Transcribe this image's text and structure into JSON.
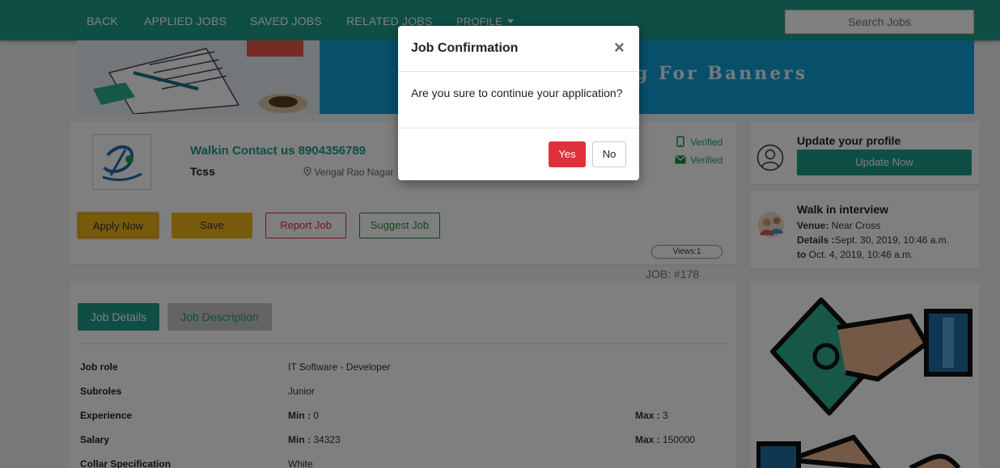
{
  "nav": {
    "back": "BACK",
    "applied": "APPLIED JOBS",
    "saved": "SAVED JOBS",
    "related": "RELATED JOBS",
    "profile": "PROFILE",
    "search_placeholder": "Search Jobs"
  },
  "banner": {
    "text": "g For Banners"
  },
  "job": {
    "title": "Walkin Contact us 8904356789",
    "company": "Tcss",
    "location": "Vengal Rao Nagar",
    "phone_verified": "Verified",
    "email_verified": "Verified",
    "buttons": {
      "apply": "Apply Now",
      "save": "Save",
      "report": "Report Job",
      "suggest": "Suggest Job"
    },
    "views": "Views:1",
    "job_no": "JOB: #178"
  },
  "tabs": {
    "details": "Job Details",
    "description": "Job Description"
  },
  "details": {
    "job_role": {
      "label": "Job role",
      "value": "IT Software - Developer"
    },
    "subroles": {
      "label": "Subroles",
      "value": "Junior"
    },
    "experience": {
      "label": "Experience",
      "min_key": "Min :",
      "min": "0",
      "max_key": "Max :",
      "max": "3"
    },
    "salary": {
      "label": "Salary",
      "min_key": "Min :",
      "min": "34323",
      "max_key": "Max :",
      "max": "150000"
    },
    "collar": {
      "label": "Collar Specification",
      "value": "White"
    }
  },
  "sidebar": {
    "profile_title": "Update your profile",
    "update_button": "Update Now",
    "walkin_title": "Walk in interview",
    "venue_key": "Venue:",
    "venue": "Near Cross",
    "details_key": "Details :",
    "details_from": "Sept. 30, 2019, 10:46 a.m.",
    "to_key": "to",
    "details_to": "Oct. 4, 2019, 10:46 a.m."
  },
  "modal": {
    "title": "Job Confirmation",
    "close": "×",
    "body": "Are you sure to continue your application?",
    "yes": "Yes",
    "no": "No"
  },
  "colors": {
    "primary": "#1f9c8a",
    "warning": "#f0b418",
    "danger": "#e0303c",
    "success": "#1a8f3a"
  }
}
